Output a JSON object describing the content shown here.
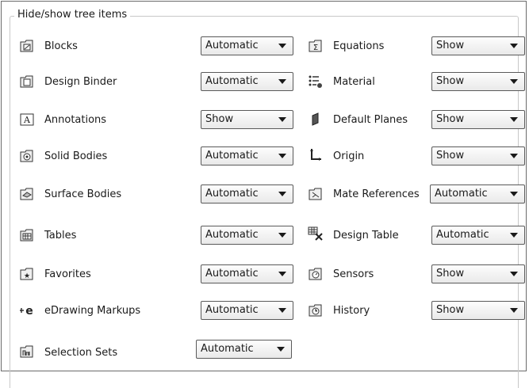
{
  "group_title": "Hide/show tree items",
  "left_items": [
    {
      "label": "Blocks",
      "value": "Automatic",
      "icon": "blocks-folder-icon"
    },
    {
      "label": "Design Binder",
      "value": "Automatic",
      "icon": "design-binder-icon"
    },
    {
      "label": "Annotations",
      "value": "Show",
      "icon": "annotations-icon"
    },
    {
      "label": "Solid Bodies",
      "value": "Automatic",
      "icon": "solid-bodies-folder-icon"
    },
    {
      "label": "Surface Bodies",
      "value": "Automatic",
      "icon": "surface-bodies-folder-icon"
    },
    {
      "label": "Tables",
      "value": "Automatic",
      "icon": "tables-folder-icon"
    },
    {
      "label": "Favorites",
      "value": "Automatic",
      "icon": "favorites-folder-icon"
    },
    {
      "label": "eDrawing Markups",
      "value": "Automatic",
      "icon": "edrawing-markups-icon"
    },
    {
      "label": "Selection Sets",
      "value": "Automatic",
      "icon": "selection-sets-folder-icon"
    }
  ],
  "right_items": [
    {
      "label": "Equations",
      "value": "Show",
      "icon": "equations-folder-icon"
    },
    {
      "label": "Material",
      "value": "Show",
      "icon": "material-icon"
    },
    {
      "label": "Default Planes",
      "value": "Show",
      "icon": "default-planes-icon"
    },
    {
      "label": "Origin",
      "value": "Show",
      "icon": "origin-icon"
    },
    {
      "label": "Mate References",
      "value": "Automatic",
      "icon": "mate-references-folder-icon"
    },
    {
      "label": "Design Table",
      "value": "Automatic",
      "icon": "design-table-icon"
    },
    {
      "label": "Sensors",
      "value": "Show",
      "icon": "sensors-folder-icon"
    },
    {
      "label": "History",
      "value": "Show",
      "icon": "history-folder-icon"
    }
  ]
}
